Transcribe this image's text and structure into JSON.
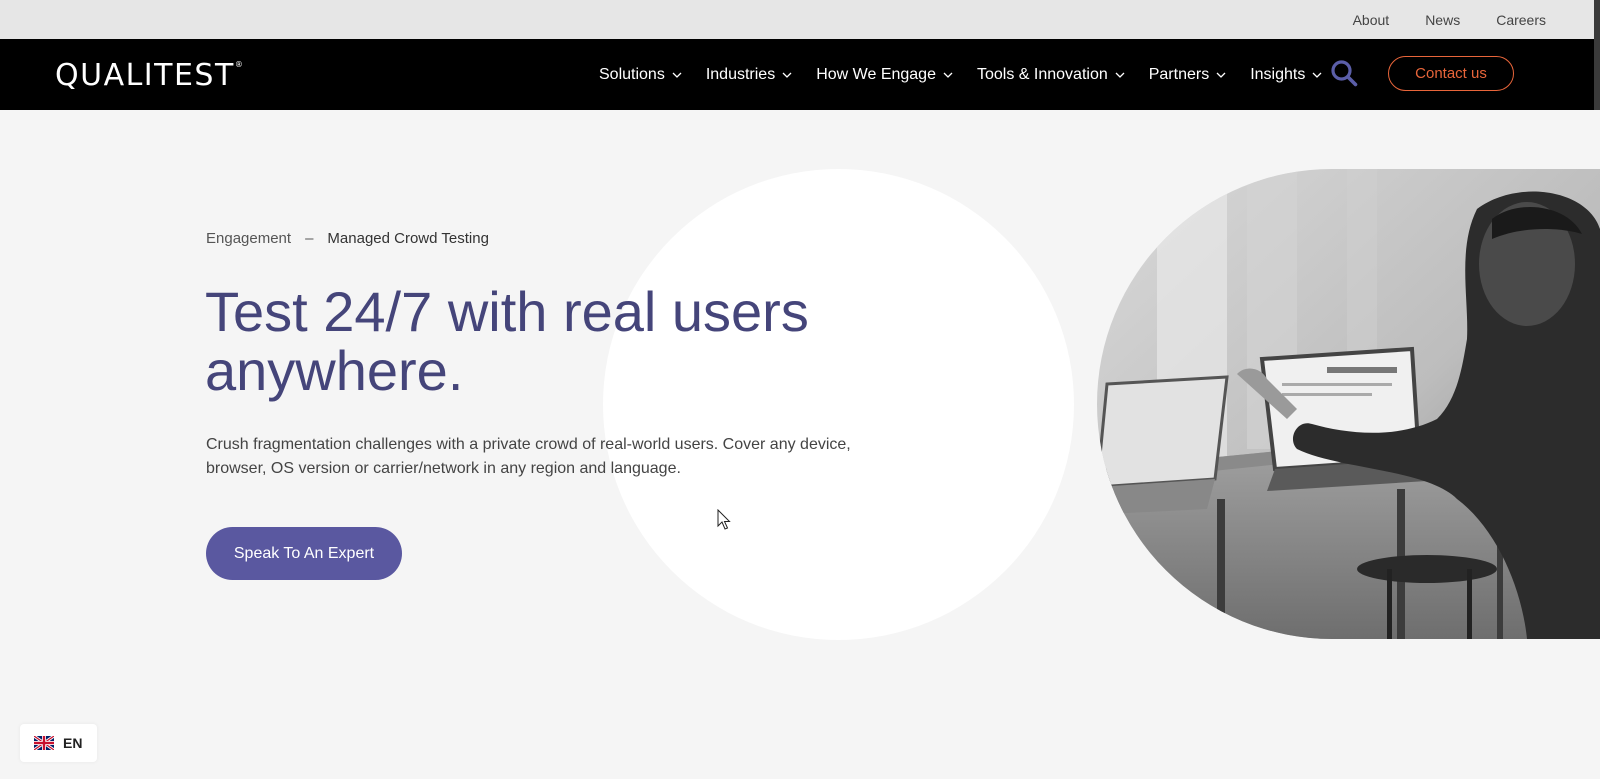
{
  "top_bar": {
    "links": [
      "About",
      "News",
      "Careers"
    ]
  },
  "brand": {
    "logo_text": "QUALITEST",
    "logo_mark": "®"
  },
  "nav": {
    "items": [
      "Solutions",
      "Industries",
      "How We Engage",
      "Tools & Innovation",
      "Partners",
      "Insights"
    ],
    "contact_label": "Contact us"
  },
  "breadcrumb": {
    "parent": "Engagement",
    "separator": "–",
    "current": "Managed Crowd Testing"
  },
  "hero": {
    "title_line1": "Test 24/7 with real users",
    "title_line2": "anywhere.",
    "description": "Crush fragmentation challenges with a private crowd of real-world users. Cover any device, browser, OS version or carrier/network in any region and language.",
    "cta_label": "Speak To An Expert"
  },
  "language": {
    "code": "EN",
    "flag_icon": "uk-flag-icon"
  },
  "colors": {
    "accent_purple": "#45457a",
    "cta_purple": "#5a58a0",
    "contact_orange": "#e8653a",
    "search_icon": "#5b5ea8",
    "nav_bg": "#000000"
  }
}
